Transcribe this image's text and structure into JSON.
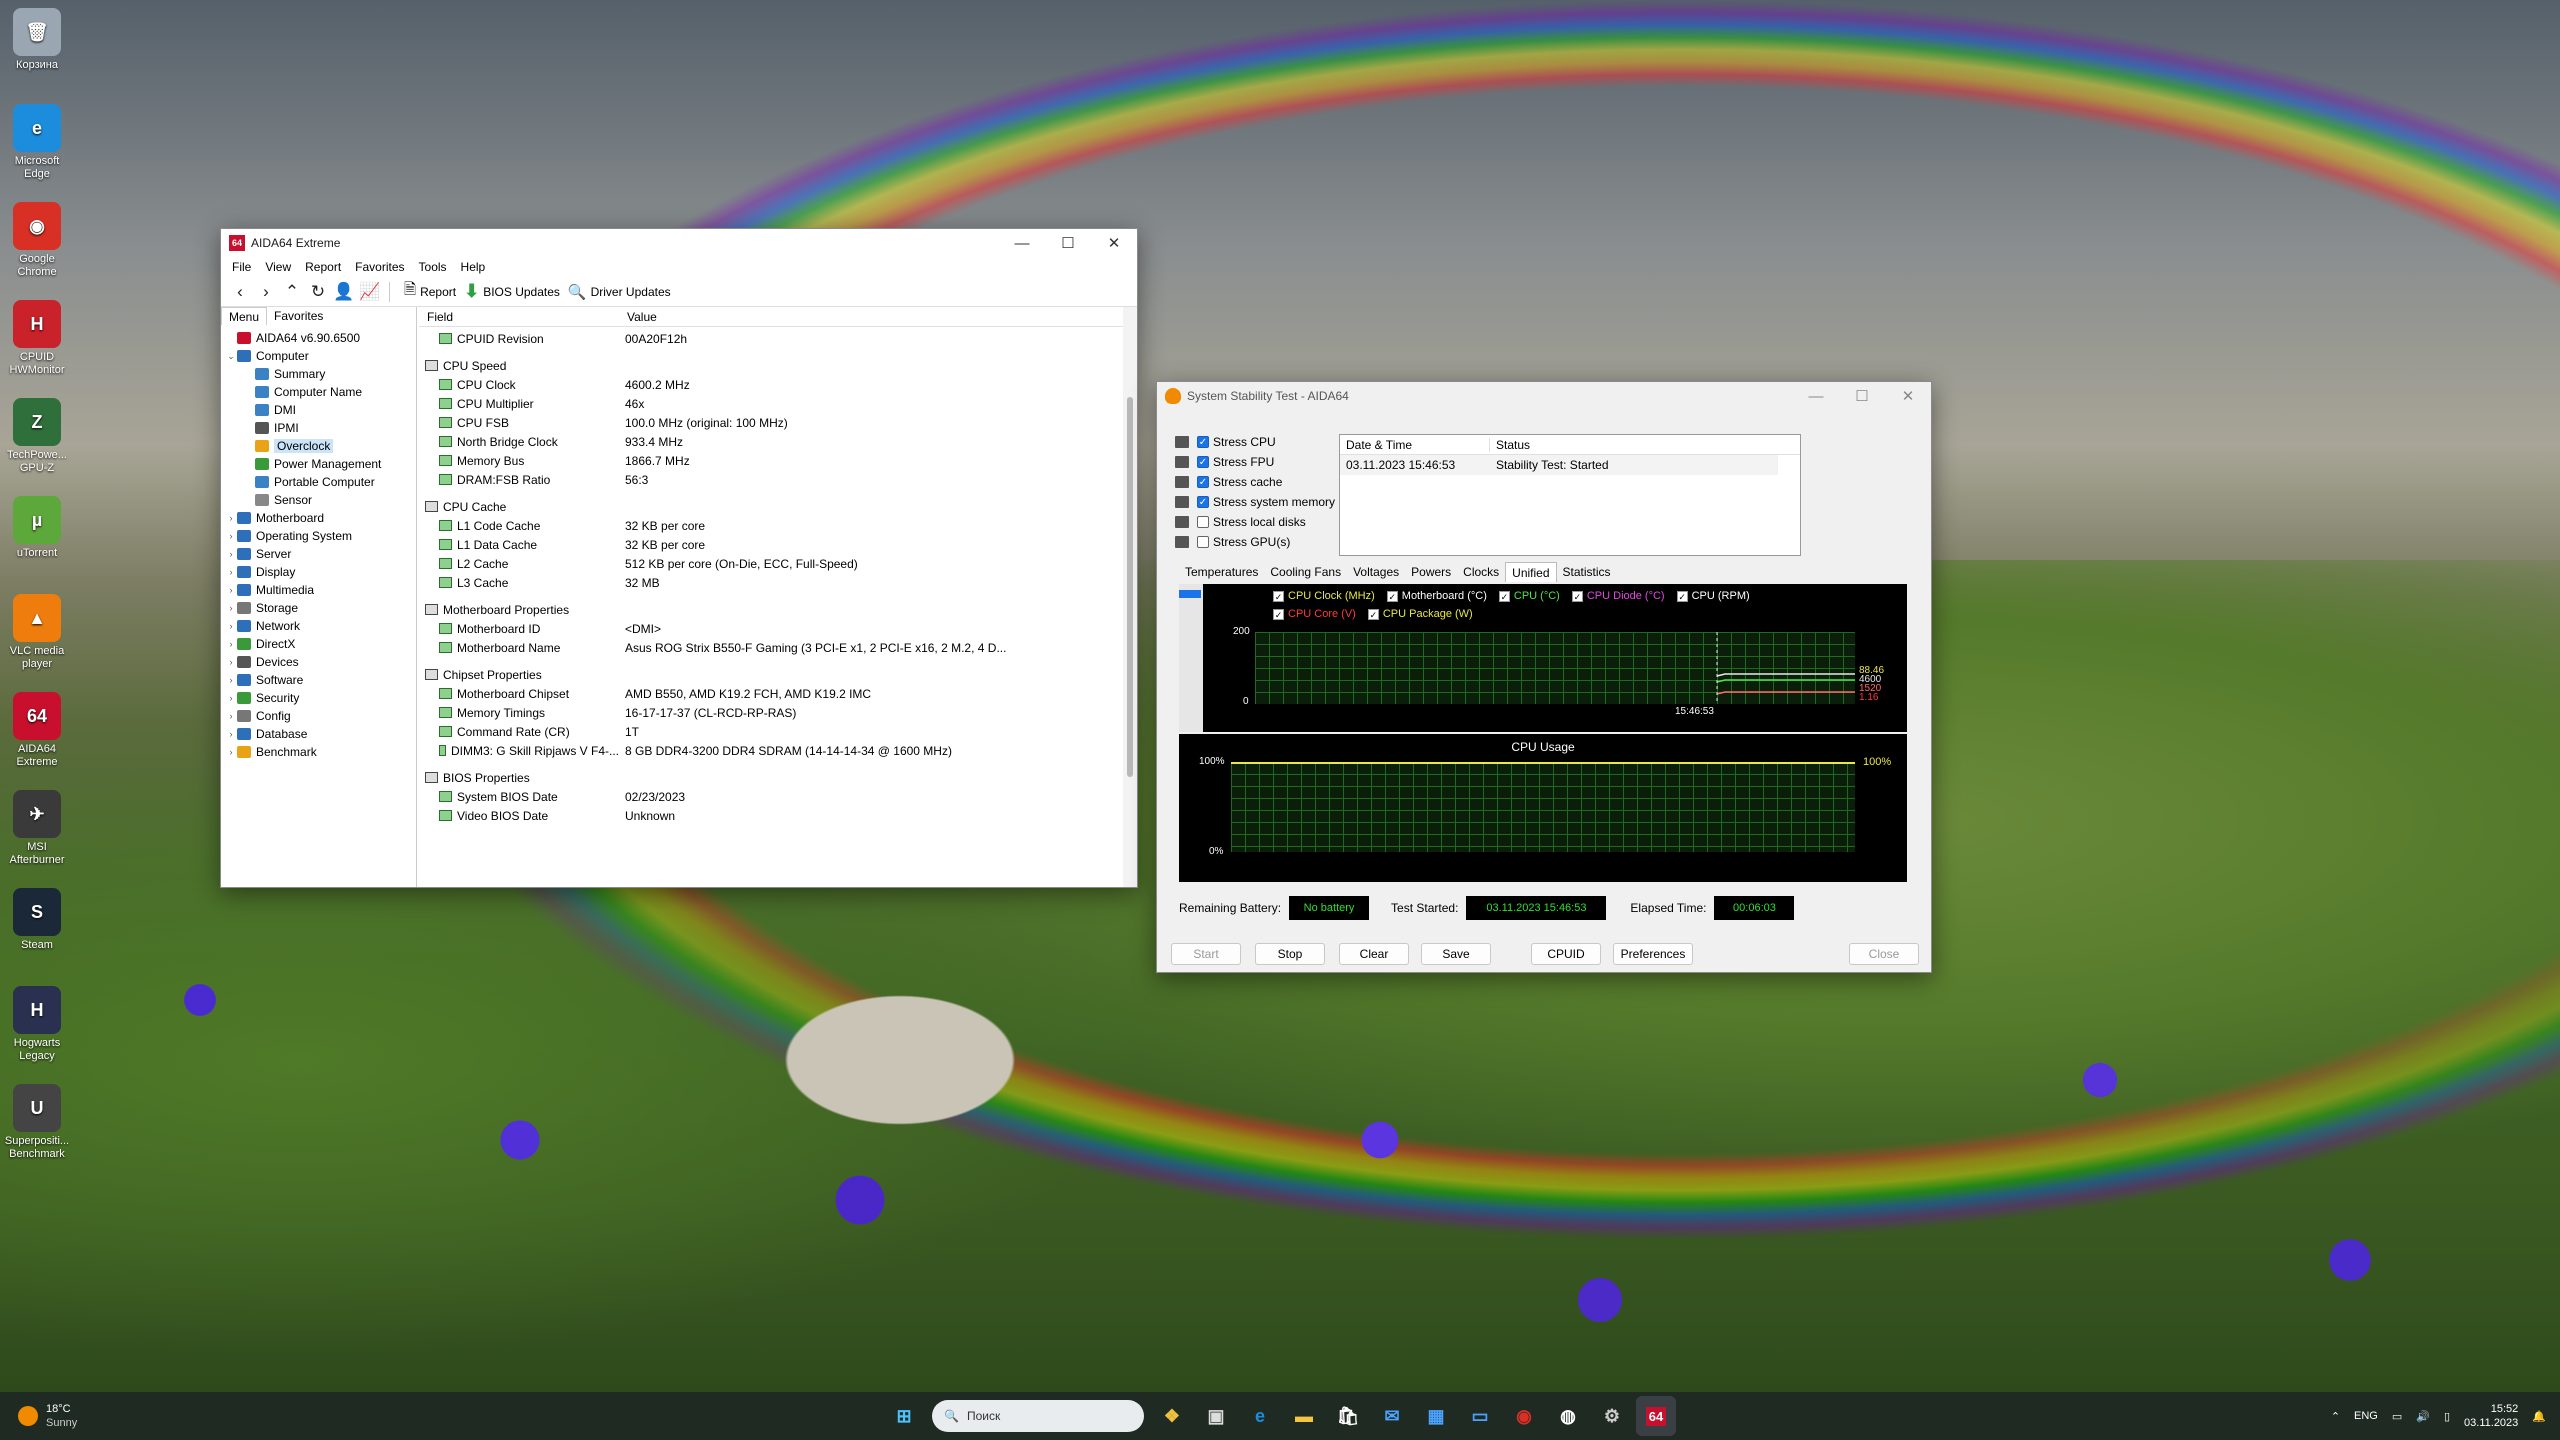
{
  "desktop": {
    "icons": [
      {
        "label": "Корзина",
        "glyph": "🗑",
        "color": "#9aa6b2"
      },
      {
        "label": "Microsoft Edge",
        "glyph": "e",
        "color": "#1c8ddc"
      },
      {
        "label": "Google Chrome",
        "glyph": "◉",
        "color": "#d93025"
      },
      {
        "label": "CPUID HWMonitor",
        "glyph": "H",
        "color": "#c9222b"
      },
      {
        "label": "TechPowe... GPU-Z",
        "glyph": "Z",
        "color": "#2f6f3b"
      },
      {
        "label": "uTorrent",
        "glyph": "µ",
        "color": "#5da83a"
      },
      {
        "label": "VLC media player",
        "glyph": "▲",
        "color": "#ee7d0e"
      },
      {
        "label": "AIDA64 Extreme",
        "glyph": "64",
        "color": "#c8102e"
      },
      {
        "label": "MSI Afterburner",
        "glyph": "✈",
        "color": "#3a3a3a"
      },
      {
        "label": "Steam",
        "glyph": "S",
        "color": "#1b2838"
      },
      {
        "label": "Hogwarts Legacy",
        "glyph": "H",
        "color": "#2a3050"
      },
      {
        "label": "Superpositi... Benchmark",
        "glyph": "U",
        "color": "#444"
      }
    ]
  },
  "aida": {
    "title": "AIDA64 Extreme",
    "menu": [
      "File",
      "View",
      "Report",
      "Favorites",
      "Tools",
      "Help"
    ],
    "toolbar": {
      "report": "Report",
      "bios": "BIOS Updates",
      "driver": "Driver Updates"
    },
    "tabs": [
      "Menu",
      "Favorites"
    ],
    "tree": [
      {
        "label": "AIDA64 v6.90.6500",
        "level": 0,
        "exp": "",
        "color": "#c8102e"
      },
      {
        "label": "Computer",
        "level": 0,
        "exp": "⌄",
        "color": "#2d6fb8"
      },
      {
        "label": "Summary",
        "level": 1,
        "exp": "",
        "color": "#3b82c4"
      },
      {
        "label": "Computer Name",
        "level": 1,
        "exp": "",
        "color": "#3b82c4"
      },
      {
        "label": "DMI",
        "level": 1,
        "exp": "",
        "color": "#3b82c4"
      },
      {
        "label": "IPMI",
        "level": 1,
        "exp": "",
        "color": "#555"
      },
      {
        "label": "Overclock",
        "level": 1,
        "exp": "",
        "color": "#e8a317",
        "selected": true
      },
      {
        "label": "Power Management",
        "level": 1,
        "exp": "",
        "color": "#3a9a3a"
      },
      {
        "label": "Portable Computer",
        "level": 1,
        "exp": "",
        "color": "#3b82c4"
      },
      {
        "label": "Sensor",
        "level": 1,
        "exp": "",
        "color": "#888"
      },
      {
        "label": "Motherboard",
        "level": 0,
        "exp": "›",
        "color": "#2d6fb8"
      },
      {
        "label": "Operating System",
        "level": 0,
        "exp": "›",
        "color": "#2d6fb8"
      },
      {
        "label": "Server",
        "level": 0,
        "exp": "›",
        "color": "#2d6fb8"
      },
      {
        "label": "Display",
        "level": 0,
        "exp": "›",
        "color": "#2d6fb8"
      },
      {
        "label": "Multimedia",
        "level": 0,
        "exp": "›",
        "color": "#2d6fb8"
      },
      {
        "label": "Storage",
        "level": 0,
        "exp": "›",
        "color": "#777"
      },
      {
        "label": "Network",
        "level": 0,
        "exp": "›",
        "color": "#2d6fb8"
      },
      {
        "label": "DirectX",
        "level": 0,
        "exp": "›",
        "color": "#3a9a3a"
      },
      {
        "label": "Devices",
        "level": 0,
        "exp": "›",
        "color": "#555"
      },
      {
        "label": "Software",
        "level": 0,
        "exp": "›",
        "color": "#2d6fb8"
      },
      {
        "label": "Security",
        "level": 0,
        "exp": "›",
        "color": "#3a9a3a"
      },
      {
        "label": "Config",
        "level": 0,
        "exp": "›",
        "color": "#777"
      },
      {
        "label": "Database",
        "level": 0,
        "exp": "›",
        "color": "#2d6fb8"
      },
      {
        "label": "Benchmark",
        "level": 0,
        "exp": "›",
        "color": "#e8a317"
      }
    ],
    "columns": {
      "field": "Field",
      "value": "Value"
    },
    "rows": [
      {
        "type": "item",
        "field": "CPUID Revision",
        "value": "00A20F12h"
      },
      {
        "type": "gap"
      },
      {
        "type": "grp",
        "field": "CPU Speed",
        "value": ""
      },
      {
        "type": "item",
        "field": "CPU Clock",
        "value": "4600.2 MHz"
      },
      {
        "type": "item",
        "field": "CPU Multiplier",
        "value": "46x"
      },
      {
        "type": "item",
        "field": "CPU FSB",
        "value": "100.0 MHz  (original: 100 MHz)"
      },
      {
        "type": "item",
        "field": "North Bridge Clock",
        "value": "933.4 MHz"
      },
      {
        "type": "item",
        "field": "Memory Bus",
        "value": "1866.7 MHz"
      },
      {
        "type": "item",
        "field": "DRAM:FSB Ratio",
        "value": "56:3"
      },
      {
        "type": "gap"
      },
      {
        "type": "grp",
        "field": "CPU Cache",
        "value": ""
      },
      {
        "type": "item",
        "field": "L1 Code Cache",
        "value": "32 KB per core"
      },
      {
        "type": "item",
        "field": "L1 Data Cache",
        "value": "32 KB per core"
      },
      {
        "type": "item",
        "field": "L2 Cache",
        "value": "512 KB per core  (On-Die, ECC, Full-Speed)"
      },
      {
        "type": "item",
        "field": "L3 Cache",
        "value": "32 MB"
      },
      {
        "type": "gap"
      },
      {
        "type": "grp",
        "field": "Motherboard Properties",
        "value": ""
      },
      {
        "type": "item",
        "field": "Motherboard ID",
        "value": "<DMI>"
      },
      {
        "type": "item",
        "field": "Motherboard Name",
        "value": "Asus ROG Strix B550-F Gaming  (3 PCI-E x1, 2 PCI-E x16, 2 M.2, 4 D..."
      },
      {
        "type": "gap"
      },
      {
        "type": "grp",
        "field": "Chipset Properties",
        "value": ""
      },
      {
        "type": "item",
        "field": "Motherboard Chipset",
        "value": "AMD B550, AMD K19.2 FCH, AMD K19.2 IMC"
      },
      {
        "type": "item",
        "field": "Memory Timings",
        "value": "16-17-17-37  (CL-RCD-RP-RAS)"
      },
      {
        "type": "item",
        "field": "Command Rate (CR)",
        "value": "1T"
      },
      {
        "type": "item",
        "field": "DIMM3: G Skill Ripjaws V F4-...",
        "value": "8 GB DDR4-3200 DDR4 SDRAM  (14-14-14-34 @ 1600 MHz)"
      },
      {
        "type": "gap"
      },
      {
        "type": "grp",
        "field": "BIOS Properties",
        "value": ""
      },
      {
        "type": "item",
        "field": "System BIOS Date",
        "value": "02/23/2023"
      },
      {
        "type": "item",
        "field": "Video BIOS Date",
        "value": "Unknown"
      }
    ]
  },
  "stability": {
    "title": "System Stability Test - AIDA64",
    "options": [
      {
        "label": "Stress CPU",
        "checked": true
      },
      {
        "label": "Stress FPU",
        "checked": true
      },
      {
        "label": "Stress cache",
        "checked": true
      },
      {
        "label": "Stress system memory",
        "checked": true
      },
      {
        "label": "Stress local disks",
        "checked": false
      },
      {
        "label": "Stress GPU(s)",
        "checked": false
      }
    ],
    "log": {
      "col_date": "Date & Time",
      "col_status": "Status",
      "date": "03.11.2023 15:46:53",
      "status": "Stability Test: Started"
    },
    "tabs": [
      "Temperatures",
      "Cooling Fans",
      "Voltages",
      "Powers",
      "Clocks",
      "Unified",
      "Statistics"
    ],
    "active_tab": "Unified",
    "legend": [
      {
        "label": "CPU Clock (MHz)",
        "color": "#e8e84a"
      },
      {
        "label": "Motherboard (°C)",
        "color": "#ffffff"
      },
      {
        "label": "CPU (°C)",
        "color": "#4ae84a"
      },
      {
        "label": "CPU Diode (°C)",
        "color": "#e04ae0"
      },
      {
        "label": "CPU (RPM)",
        "color": "#ffffff"
      },
      {
        "label": "CPU Core (V)",
        "color": "#ff3a3a"
      },
      {
        "label": "CPU Package (W)",
        "color": "#e8e84a"
      }
    ],
    "graph1": {
      "ymax": "200",
      "ymin": "0",
      "time": "15:46:53",
      "readouts": [
        {
          "text": "88.46",
          "color": "#e8e84a"
        },
        {
          "text": "4600",
          "color": "#e8e8e8"
        },
        {
          "text": "1520",
          "color": "#ff6a6a"
        },
        {
          "text": "1.16",
          "color": "#ff3a3a"
        }
      ]
    },
    "graph2": {
      "title": "CPU Usage",
      "ymax": "100%",
      "ymin": "0%",
      "value": "100%"
    },
    "status": {
      "battery_label": "Remaining Battery:",
      "battery": "No battery",
      "started_label": "Test Started:",
      "started": "03.11.2023 15:46:53",
      "elapsed_label": "Elapsed Time:",
      "elapsed": "00:06:03"
    },
    "buttons": {
      "start": "Start",
      "stop": "Stop",
      "clear": "Clear",
      "save": "Save",
      "cpuid": "CPUID",
      "preferences": "Preferences",
      "close": "Close"
    }
  },
  "taskbar": {
    "weather_temp": "18°C",
    "weather_text": "Sunny",
    "search_placeholder": "Поиск",
    "lang": "ENG",
    "time": "15:52",
    "date": "03.11.2023"
  }
}
